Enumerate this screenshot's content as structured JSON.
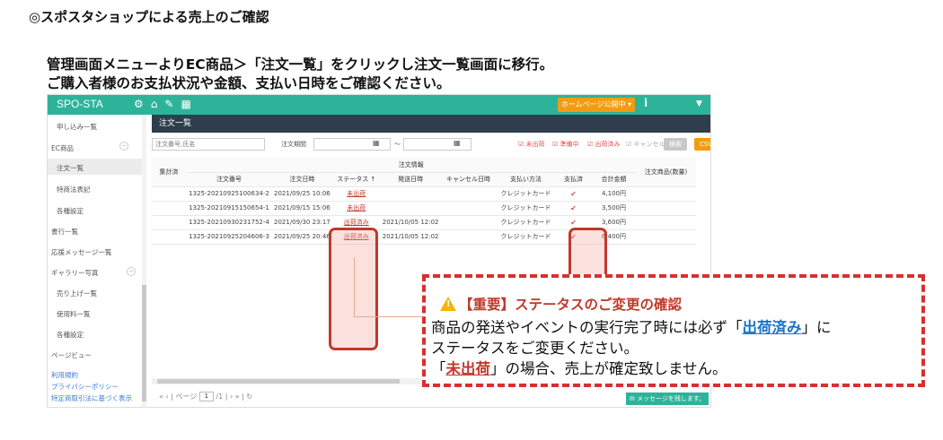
{
  "heading": "◎スポスタショップによる売上のご確認",
  "instruction_line1": "管理画面メニューよりEC商品＞「注文一覧」をクリックし注文一覧画面に移行。",
  "instruction_line2": "ご購入者様のお支払状況や金額、支払い日時をご確認ください。",
  "app": {
    "brand": "SPO-STA",
    "publish_button": "ホームページ公開中 ▾",
    "info_icon": "i",
    "menu_caret": "▼"
  },
  "sidebar": {
    "items": [
      {
        "label": "申し込み一覧"
      },
      {
        "label": "EC商品"
      },
      {
        "label": "注文一覧"
      },
      {
        "label": "特商法表記"
      },
      {
        "label": "各種設定"
      },
      {
        "label": "書行一覧"
      },
      {
        "label": "応援メッセージ一覧"
      },
      {
        "label": "ギャラリー写真"
      },
      {
        "label": "売り上げ一覧"
      },
      {
        "label": "使用料一覧"
      },
      {
        "label": "各種設定"
      },
      {
        "label": "ページビュー"
      },
      {
        "label": "利用規約"
      },
      {
        "label": "プライバシーポリシー"
      },
      {
        "label": "特定商取引法に基づく表示"
      }
    ]
  },
  "panel_title": "注文一覧",
  "filters": {
    "order_placeholder": "注文番号,氏名",
    "period_label": "注文期間",
    "range_sep": "～",
    "checks": [
      "☑ 未出荷",
      "☑ 準備中",
      "☑ 出荷済み",
      "☑ キャンセル"
    ],
    "search_button": "検索",
    "csv_button": "CSV"
  },
  "table": {
    "col_aggregated": "集計済",
    "group_header": "注文情報",
    "col_total_items": "注文商品(数量)",
    "headers": [
      "注文番号",
      "注文日時",
      "ステータス ↑",
      "発送日時",
      "キャンセル日時",
      "支払い方法",
      "支払済",
      "合計金額"
    ],
    "rows": [
      {
        "order_no": "1325-20210925100634-2",
        "date": "2021/09/25 10:06",
        "status": "未出荷",
        "ship": "",
        "cancel": "",
        "method": "クレジットカード",
        "paid": "✔",
        "total": "4,100円"
      },
      {
        "order_no": "1325-20210915150654-1",
        "date": "2021/09/15 15:06",
        "status": "未出荷",
        "ship": "",
        "cancel": "",
        "method": "クレジットカード",
        "paid": "✔",
        "total": "3,500円"
      },
      {
        "order_no": "1325-20210930231752-4",
        "date": "2021/09/30 23:17",
        "status": "出荷済み",
        "ship": "2021/10/05 12:02",
        "cancel": "",
        "method": "クレジットカード",
        "paid": "✔",
        "total": "3,600円"
      },
      {
        "order_no": "1325-20210925204606-3",
        "date": "2021/09/25 20:46",
        "status": "出荷済み",
        "ship": "2021/10/05 12:02",
        "cancel": "",
        "method": "クレジットカード",
        "paid": "✔",
        "total": "6,400円"
      }
    ]
  },
  "pager": {
    "prev": "«  ‹",
    "page_label": "ページ",
    "page_value": "1",
    "of_total": "/1",
    "next": "›  »",
    "refresh": "↻"
  },
  "message_button": "✉  メッセージを残します。",
  "callout": {
    "title": "【重要】ステータスのご変更の確認",
    "line1_pre": "商品の発送やイベントの実行完了時には必ず「",
    "line1_link": "出荷済み",
    "line1_post": "」に",
    "line2": "ステータスをご変更ください。",
    "line3_pre": "「",
    "line3_link": "未出荷",
    "line3_post": "」の場合、売上が確定致しません。"
  }
}
